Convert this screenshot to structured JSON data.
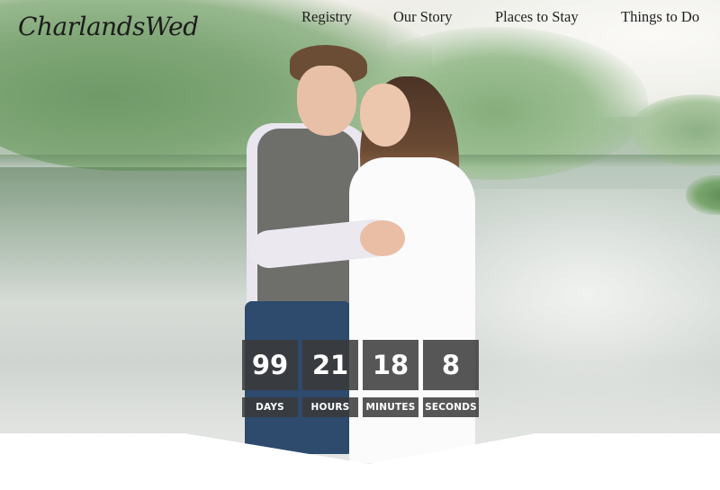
{
  "brand": {
    "logo_text": "CharlandsWed"
  },
  "nav": {
    "items": [
      {
        "label": "Registry"
      },
      {
        "label": "Our Story"
      },
      {
        "label": "Places to Stay"
      },
      {
        "label": "Things to Do"
      }
    ]
  },
  "countdown": {
    "days": {
      "value": "99",
      "label": "DAYS"
    },
    "hours": {
      "value": "21",
      "label": "HOURS"
    },
    "minutes": {
      "value": "18",
      "label": "MINUTES"
    },
    "seconds": {
      "value": "8",
      "label": "SECONDS"
    }
  },
  "colors": {
    "countdown_bg": "#3a3a3a",
    "countdown_text": "#ffffff",
    "nav_text": "#1e1e1e",
    "page_bg": "#ffffff"
  },
  "hero": {
    "image_subject": "couple-embracing-by-river"
  }
}
